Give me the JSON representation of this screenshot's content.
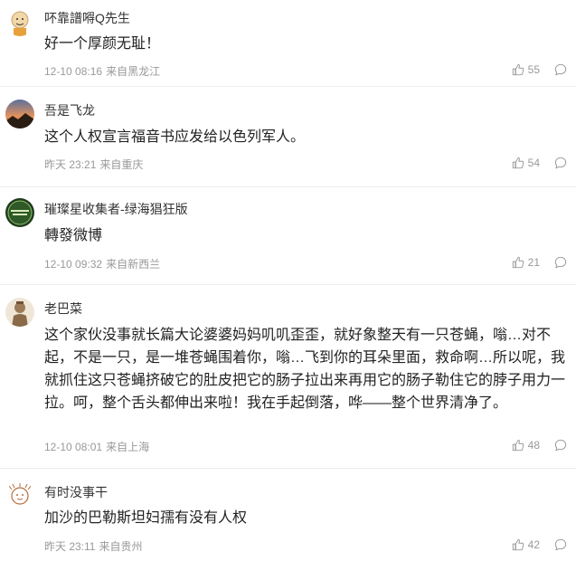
{
  "comments": [
    {
      "user": "吥靠譜嘚Q先生",
      "text": "好一个厚颜无耻！",
      "time": "12-10 08:16",
      "location": "来自黑龙江",
      "likes": "55",
      "avatar": "cartoon-bald-avatar"
    },
    {
      "user": "吾是飞龙",
      "text": "这个人权宣言福音书应发给以色列军人。",
      "time": "昨天 23:21",
      "location": "来自重庆",
      "likes": "54",
      "avatar": "sunset-photo-avatar"
    },
    {
      "user": "璀璨星收集者-绿海猖狂版",
      "text": "轉發微博",
      "time": "12-10 09:32",
      "location": "来自新西兰",
      "likes": "21",
      "avatar": "dark-green-badge-avatar"
    },
    {
      "user": "老巴菜",
      "text": "这个家伙没事就长篇大论婆婆妈妈叽叽歪歪，就好象整天有一只苍蝇，嗡…对不起，不是一只，是一堆苍蝇围着你，嗡…飞到你的耳朵里面，救命啊…所以呢，我就抓住这只苍蝇挤破它的肚皮把它的肠子拉出来再用它的肠子勒住它的脖子用力一拉。呵，整个舌头都伸出来啦！我在手起倒落，哗——整个世界清净了。",
      "time": "12-10 08:01",
      "location": "来自上海",
      "likes": "48",
      "avatar": "terracotta-warrior-avatar"
    },
    {
      "user": "有时没事干",
      "text": "加沙的巴勒斯坦妇孺有没有人权",
      "time": "昨天 23:11",
      "location": "来自贵州",
      "likes": "42",
      "avatar": "doodle-face-avatar"
    }
  ],
  "icons": {
    "like": "thumbs-up-icon",
    "reply": "comment-bubble-icon"
  },
  "colors": {
    "meta": "#999999",
    "divider": "#ececec"
  }
}
